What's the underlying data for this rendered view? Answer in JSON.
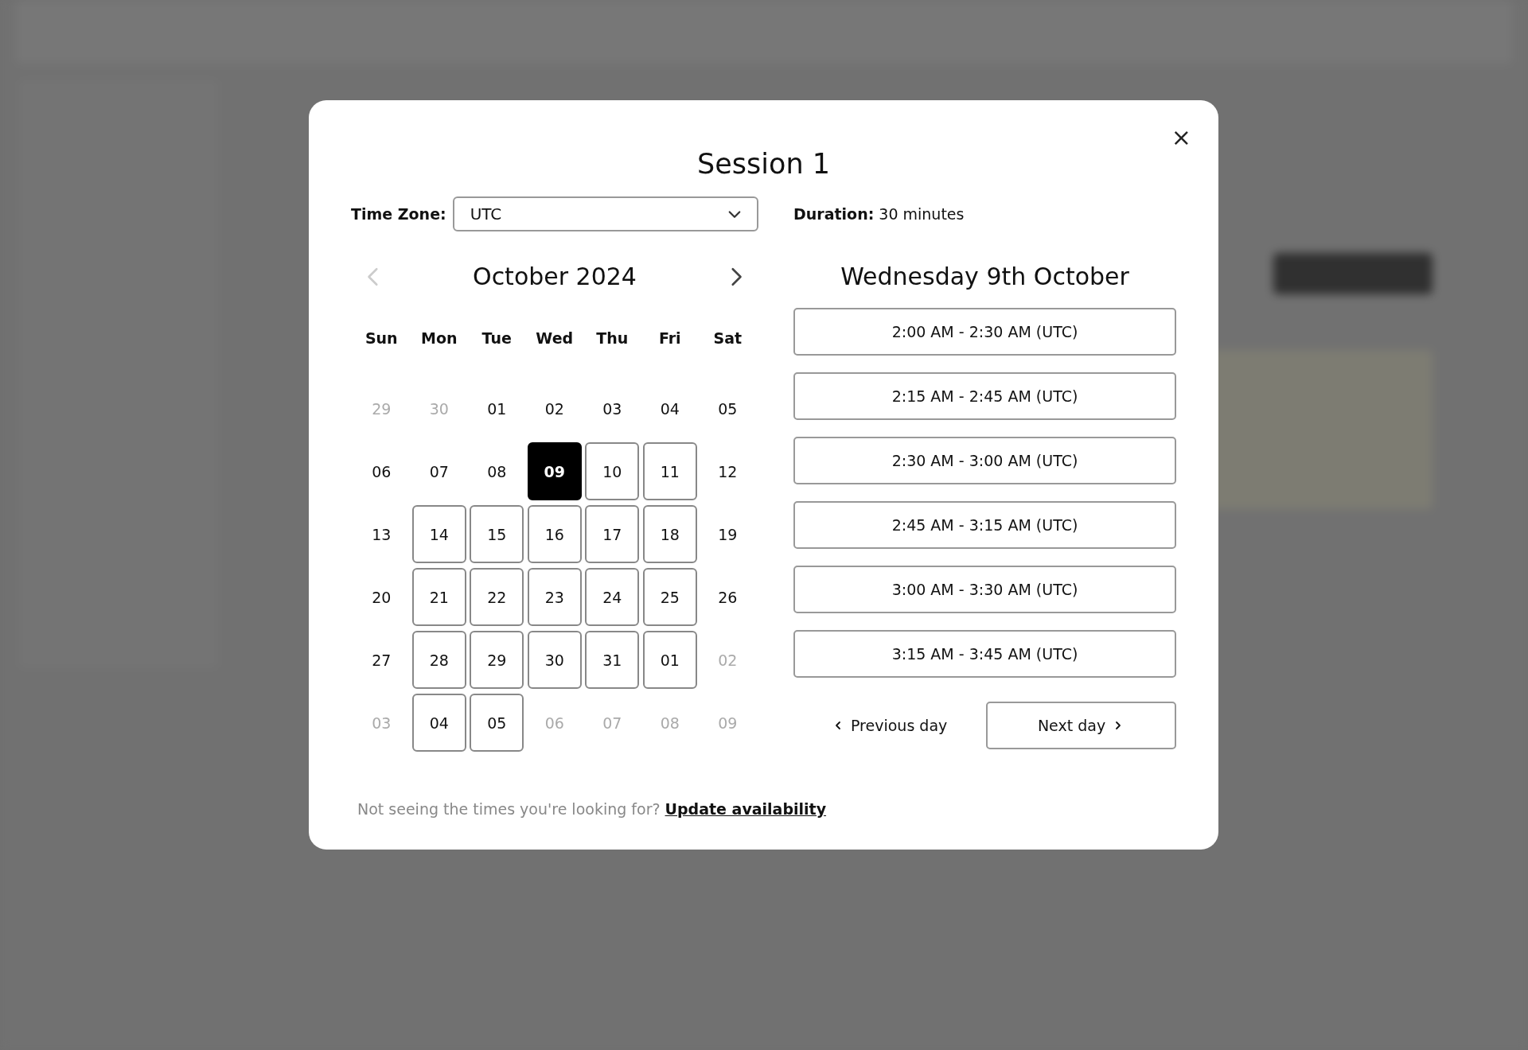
{
  "dialog": {
    "title": "Session 1",
    "close_label": "×",
    "time_zone": {
      "label": "Time Zone:",
      "value": "UTC"
    },
    "duration": {
      "label": "Duration:",
      "value": "30 minutes"
    },
    "calendar": {
      "month": "October 2024",
      "prev_disabled": true,
      "next_disabled": false,
      "weekdays": [
        "Sun",
        "Mon",
        "Tue",
        "Wed",
        "Thu",
        "Fri",
        "Sat"
      ],
      "weeks": [
        [
          {
            "day": "29",
            "outside_month": true,
            "available": false,
            "selected": false
          },
          {
            "day": "30",
            "outside_month": true,
            "available": false,
            "selected": false
          },
          {
            "day": "01",
            "outside_month": false,
            "available": false,
            "selected": false
          },
          {
            "day": "02",
            "outside_month": false,
            "available": false,
            "selected": false
          },
          {
            "day": "03",
            "outside_month": false,
            "available": false,
            "selected": false
          },
          {
            "day": "04",
            "outside_month": false,
            "available": false,
            "selected": false
          },
          {
            "day": "05",
            "outside_month": false,
            "available": false,
            "selected": false
          }
        ],
        [
          {
            "day": "06",
            "outside_month": false,
            "available": false,
            "selected": false
          },
          {
            "day": "07",
            "outside_month": false,
            "available": false,
            "selected": false
          },
          {
            "day": "08",
            "outside_month": false,
            "available": false,
            "selected": false
          },
          {
            "day": "09",
            "outside_month": false,
            "available": true,
            "selected": true
          },
          {
            "day": "10",
            "outside_month": false,
            "available": true,
            "selected": false
          },
          {
            "day": "11",
            "outside_month": false,
            "available": true,
            "selected": false
          },
          {
            "day": "12",
            "outside_month": false,
            "available": false,
            "selected": false
          }
        ],
        [
          {
            "day": "13",
            "outside_month": false,
            "available": false,
            "selected": false
          },
          {
            "day": "14",
            "outside_month": false,
            "available": true,
            "selected": false
          },
          {
            "day": "15",
            "outside_month": false,
            "available": true,
            "selected": false
          },
          {
            "day": "16",
            "outside_month": false,
            "available": true,
            "selected": false
          },
          {
            "day": "17",
            "outside_month": false,
            "available": true,
            "selected": false
          },
          {
            "day": "18",
            "outside_month": false,
            "available": true,
            "selected": false
          },
          {
            "day": "19",
            "outside_month": false,
            "available": false,
            "selected": false
          }
        ],
        [
          {
            "day": "20",
            "outside_month": false,
            "available": false,
            "selected": false
          },
          {
            "day": "21",
            "outside_month": false,
            "available": true,
            "selected": false
          },
          {
            "day": "22",
            "outside_month": false,
            "available": true,
            "selected": false
          },
          {
            "day": "23",
            "outside_month": false,
            "available": true,
            "selected": false
          },
          {
            "day": "24",
            "outside_month": false,
            "available": true,
            "selected": false
          },
          {
            "day": "25",
            "outside_month": false,
            "available": true,
            "selected": false
          },
          {
            "day": "26",
            "outside_month": false,
            "available": false,
            "selected": false
          }
        ],
        [
          {
            "day": "27",
            "outside_month": false,
            "available": false,
            "selected": false
          },
          {
            "day": "28",
            "outside_month": false,
            "available": true,
            "selected": false
          },
          {
            "day": "29",
            "outside_month": false,
            "available": true,
            "selected": false
          },
          {
            "day": "30",
            "outside_month": false,
            "available": true,
            "selected": false
          },
          {
            "day": "31",
            "outside_month": false,
            "available": true,
            "selected": false
          },
          {
            "day": "01",
            "outside_month": true,
            "available": true,
            "selected": false
          },
          {
            "day": "02",
            "outside_month": true,
            "available": false,
            "selected": false
          }
        ],
        [
          {
            "day": "03",
            "outside_month": true,
            "available": false,
            "selected": false
          },
          {
            "day": "04",
            "outside_month": true,
            "available": true,
            "selected": false
          },
          {
            "day": "05",
            "outside_month": true,
            "available": true,
            "selected": false
          },
          {
            "day": "06",
            "outside_month": true,
            "available": false,
            "selected": false
          },
          {
            "day": "07",
            "outside_month": true,
            "available": false,
            "selected": false
          },
          {
            "day": "08",
            "outside_month": true,
            "available": false,
            "selected": false
          },
          {
            "day": "09",
            "outside_month": true,
            "available": false,
            "selected": false
          }
        ]
      ]
    },
    "slots_heading": "Wednesday 9th October",
    "slots": [
      "2:00 AM - 2:30 AM (UTC)",
      "2:15 AM - 2:45 AM (UTC)",
      "2:30 AM - 3:00 AM (UTC)",
      "2:45 AM - 3:15 AM (UTC)",
      "3:00 AM - 3:30 AM (UTC)",
      "3:15 AM - 3:45 AM (UTC)"
    ],
    "previous_day": "Previous day",
    "next_day": "Next day",
    "footer": {
      "text": "Not seeing the times you're looking for?",
      "link": "Update availability"
    }
  }
}
